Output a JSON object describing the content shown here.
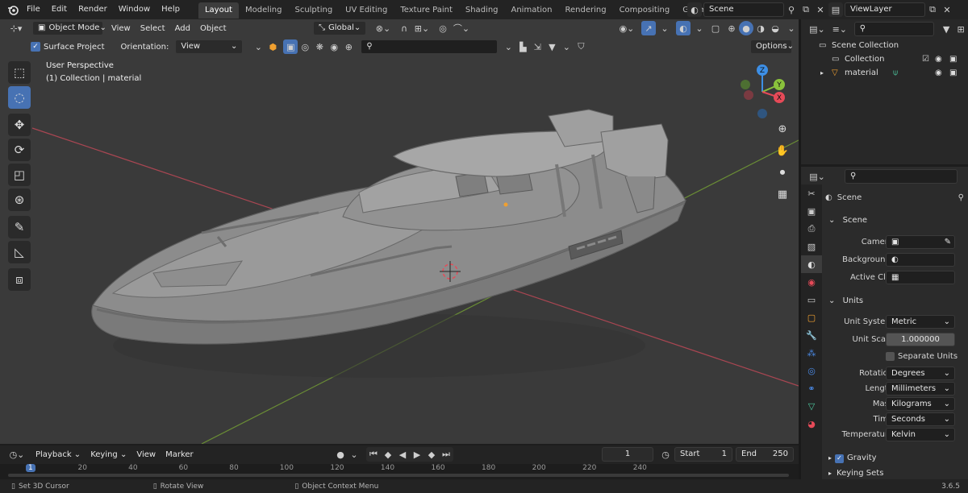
{
  "topbar": {
    "menus": [
      "File",
      "Edit",
      "Render",
      "Window",
      "Help"
    ],
    "workspaces": [
      "Layout",
      "Modeling",
      "Sculpting",
      "UV Editing",
      "Texture Paint",
      "Shading",
      "Animation",
      "Rendering",
      "Compositing",
      "Geometry Noc"
    ],
    "scene_name": "Scene",
    "view_layer": "ViewLayer"
  },
  "viewport": {
    "mode": "Object Mode",
    "menus": [
      "View",
      "Select",
      "Add",
      "Object"
    ],
    "transform_orientation": "Global",
    "surface_project_label": "Surface Project",
    "orientation_label": "Orientation:",
    "orientation_value": "View",
    "options_label": "Options",
    "overlay_line1": "User Perspective",
    "overlay_line2": "(1) Collection | material",
    "gizmo_axes": {
      "x": "X",
      "y": "Y",
      "z": "Z"
    }
  },
  "outliner": {
    "items": [
      {
        "label": "Scene Collection"
      },
      {
        "label": "Collection"
      },
      {
        "label": "material"
      }
    ]
  },
  "properties": {
    "context_label": "Scene",
    "scene_panel": {
      "title": "Scene",
      "camera_label": "Camera",
      "background_label": "Backgroun...",
      "active_clip_label": "Active Clip"
    },
    "units_panel": {
      "title": "Units",
      "unit_system_label": "Unit System",
      "unit_system": "Metric",
      "unit_scale_label": "Unit Scale",
      "unit_scale": "1.000000",
      "separate_units_label": "Separate Units",
      "rotation_label": "Rotation",
      "rotation": "Degrees",
      "length_label": "Length",
      "length": "Millimeters",
      "mass_label": "Mass",
      "mass": "Kilograms",
      "time_label": "Time",
      "time": "Seconds",
      "temperature_label": "Temperature",
      "temperature": "Kelvin"
    },
    "gravity_label": "Gravity",
    "keying_sets_label": "Keying Sets"
  },
  "timeline": {
    "menus": [
      "Playback",
      "Keying",
      "View",
      "Marker"
    ],
    "current_frame": "1",
    "start_label": "Start",
    "start": "1",
    "end_label": "End",
    "end": "250",
    "ruler_ticks": [
      "1",
      "20",
      "40",
      "60",
      "80",
      "100",
      "120",
      "140",
      "160",
      "180",
      "200",
      "220",
      "240"
    ]
  },
  "statusbar": {
    "hint1": "Set 3D Cursor",
    "hint2": "Rotate View",
    "hint3": "Object Context Menu",
    "version": "3.6.5"
  },
  "colors": {
    "accent": "#4772b3",
    "x_axis": "#e64a58",
    "y_axis": "#8ac23c",
    "z_axis": "#3d8fe6"
  }
}
